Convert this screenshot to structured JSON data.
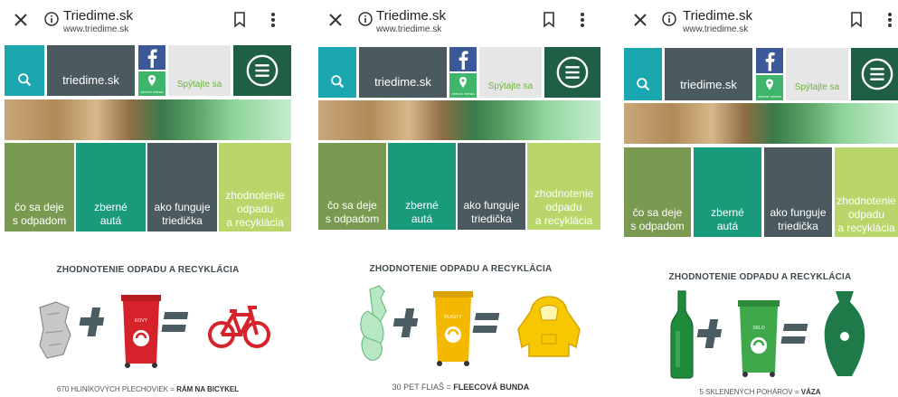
{
  "browser": {
    "site_title": "Triedime.sk",
    "site_url": "www.triedime.sk"
  },
  "tiles": {
    "logo": "triedime.sk",
    "pin_label": "zberné miesta",
    "ask": "Spýtajte sa"
  },
  "categories": [
    {
      "label_line1": "čo sa deje",
      "label_line2": "s odpadom"
    },
    {
      "label_line1": "zberné",
      "label_line2": "autá"
    },
    {
      "label_line1": "ako funguje",
      "label_line2": "triedička"
    },
    {
      "label_line1": "zhodnotenie",
      "label_line2": "odpadu",
      "label_line3": "a recyklácia"
    }
  ],
  "heading": "ZHODNOTENIE ODPADU A RECYKLÁCIA",
  "panels": [
    {
      "bin_label": "KOVY",
      "caption_prefix": "670 HLINÍKOVÝCH PLECHOVIEK = ",
      "caption_result": "RÁM NA BICYKEL",
      "bin_color": "#d6222a"
    },
    {
      "bin_label": "PLASTY",
      "caption_prefix": "30 PET FLIAŠ = ",
      "caption_result": "FLEECOVÁ BUNDA",
      "bin_color": "#f5b800"
    },
    {
      "bin_label": "SKLO",
      "caption_prefix": "5 SKLENENÝCH POHÁROV = ",
      "caption_result": "VÁZA",
      "bin_color": "#3fa84a"
    }
  ],
  "colors": {
    "operator": "#4b5c63",
    "bike": "#d6222a",
    "jacket": "#f5c800",
    "glass": "#1f8a3a"
  }
}
